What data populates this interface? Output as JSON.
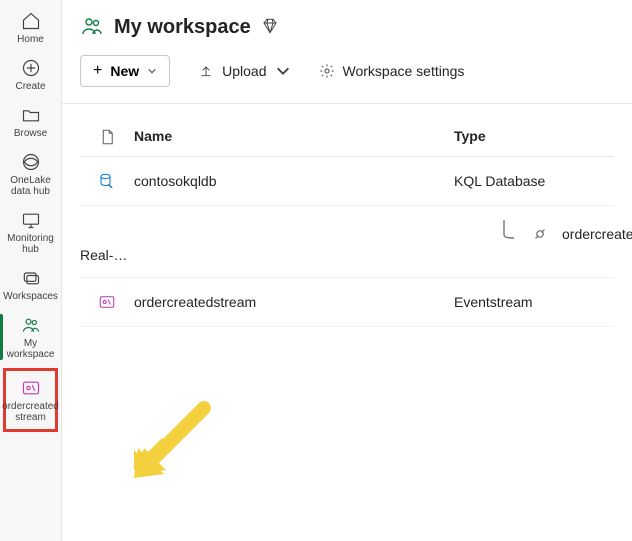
{
  "sidebar": {
    "items": [
      {
        "label": "Home"
      },
      {
        "label": "Create"
      },
      {
        "label": "Browse"
      },
      {
        "label": "OneLake data hub"
      },
      {
        "label": "Monitoring hub"
      },
      {
        "label": "Workspaces"
      },
      {
        "label": "My workspace"
      },
      {
        "label": "ordercreatedstream"
      }
    ]
  },
  "header": {
    "title": "My workspace"
  },
  "toolbar": {
    "new_label": "New",
    "upload_label": "Upload",
    "settings_label": "Workspace settings"
  },
  "table": {
    "columns": {
      "name": "Name",
      "type": "Type"
    },
    "rows": [
      {
        "name": "contosokqldb",
        "type": "KQL Database",
        "child": false
      },
      {
        "name": "ordercreatedstream_contosokqldb",
        "type": "Real-Time Analytic...",
        "child": true
      },
      {
        "name": "ordercreatedstream",
        "type": "Eventstream",
        "child": false
      }
    ]
  }
}
